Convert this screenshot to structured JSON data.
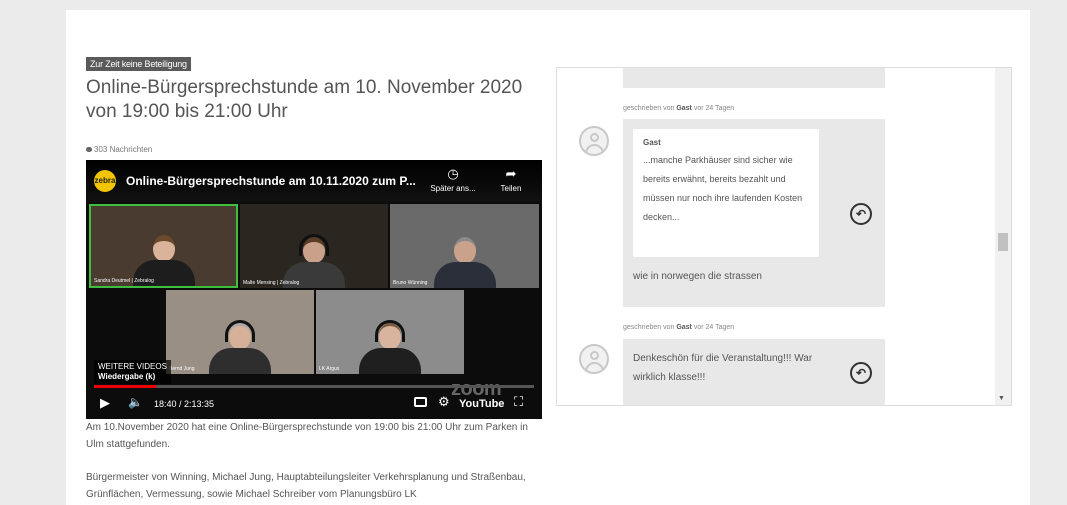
{
  "status_badge": "Zur Zeit keine Beteiligung",
  "page_title": "Online-Bürgersprechstunde am 10. November 2020 von 19:00 bis 21:00 Uhr",
  "messages_count": "303 Nachrichten",
  "video": {
    "logo": "zebra",
    "title": "Online-Bürgersprechstunde am 10.11.2020 zum P...",
    "watch_later_label": "Später ans...",
    "share_label": "Teilen",
    "more_videos_label": "WEITERE VIDEOS",
    "playback_label": "Wiedergabe (k)",
    "time": "18:40 / 2:13:35",
    "brand_overlay": "zoom",
    "youtube_label": "YouTube",
    "progress": 0.14,
    "participants": [
      {
        "name": "Sandra Deutmel | Zebralog"
      },
      {
        "name": "Malte Mensing | Zebralog"
      },
      {
        "name": "Bruno Wünning"
      },
      {
        "name": "Bernd Jung"
      },
      {
        "name": "LK Argus"
      }
    ]
  },
  "body_paragraphs": [
    "Am 10.November 2020 hat eine Online-Bürgersprechstunde von 19:00 bis 21:00 Uhr zum Parken in Ulm stattgefunden.",
    "Bürgermeister von Winning, Michael Jung, Hauptabteilungsleiter Verkehrsplanung und Straßenbau, Grünflächen, Vermessung, sowie Michael Schreiber vom Planungsbüro LK"
  ],
  "chat": {
    "comments": [
      {
        "meta_prefix": "geschrieben von",
        "author": "Gast",
        "meta_suffix": "vor 24 Tagen",
        "quote_author": "Gast",
        "quote_text": "...manche Parkhäuser sind sicher wie bereits erwähnt, bereits bezahlt und müssen nur noch ihre laufenden Kosten decken...",
        "text": "wie in norwegen die strassen"
      },
      {
        "meta_prefix": "geschrieben von",
        "author": "Gast",
        "meta_suffix": "vor 24 Tagen",
        "text": "Denkeschön für die Veranstaltung!!! War wirklich klasse!!!"
      }
    ]
  },
  "colors": {
    "badge_bg": "#5a5a5a",
    "progress_red": "#ee0000",
    "speaker_highlight": "#3fbf3f",
    "bubble_grey": "#e8e8e8"
  },
  "icons": {
    "watch_later": "clock-icon",
    "share": "share-arrow-icon",
    "play": "play-icon",
    "volume": "volume-icon",
    "reply": "reply-icon"
  }
}
